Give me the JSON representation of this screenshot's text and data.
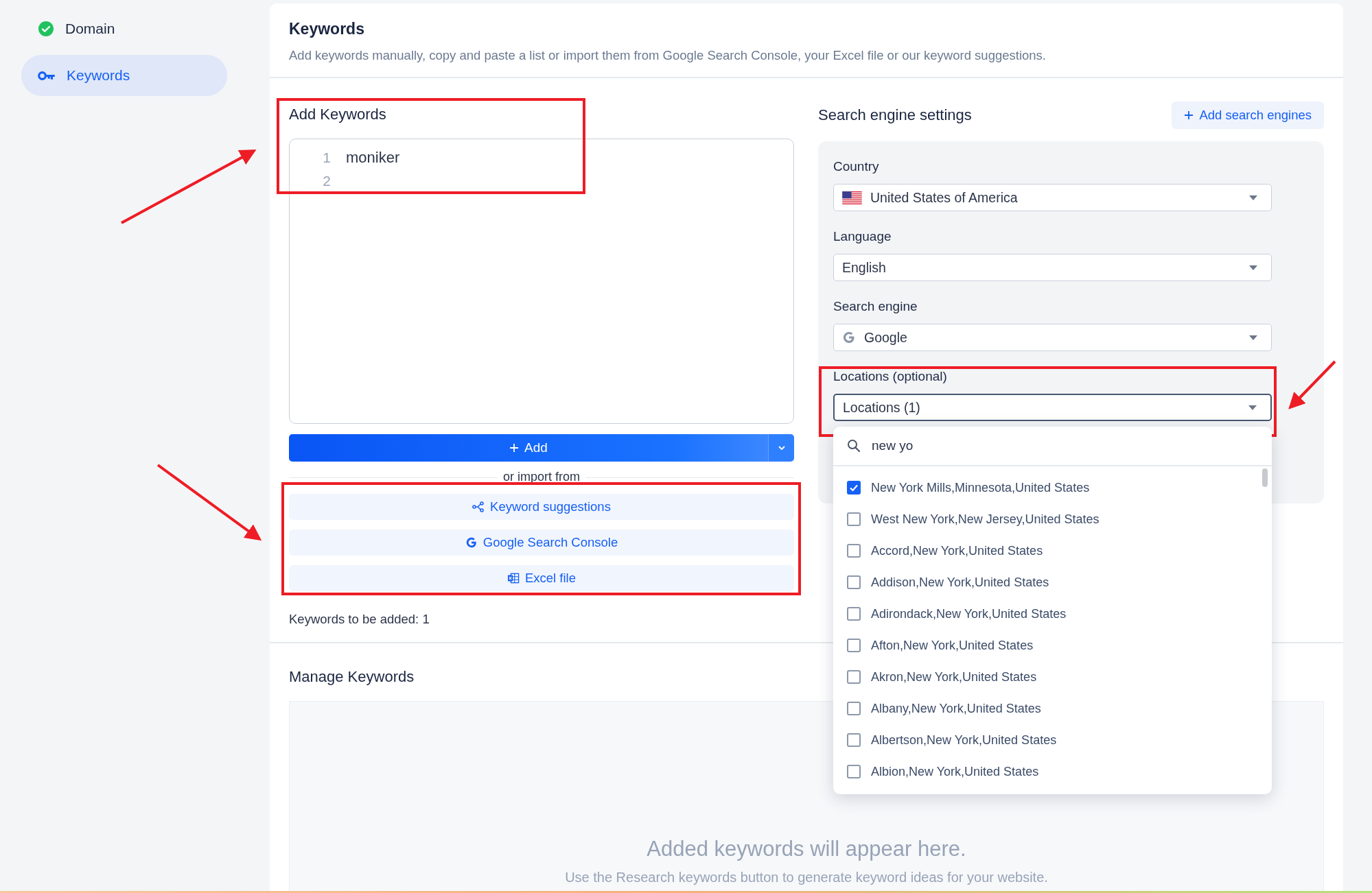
{
  "sidebar": {
    "items": [
      {
        "label": "Domain",
        "kind": "check",
        "selected": false
      },
      {
        "label": "Keywords",
        "kind": "key",
        "selected": true
      }
    ]
  },
  "header": {
    "title": "Keywords",
    "subtitle": "Add keywords manually, copy and paste a list or import them from Google Search Console, your Excel file or our keyword suggestions."
  },
  "add_keywords": {
    "title": "Add Keywords",
    "editor_lines": [
      {
        "number": "1",
        "text": "moniker"
      },
      {
        "number": "2"
      }
    ],
    "add_button": "Add",
    "divider_label": "or import from",
    "import_buttons": [
      {
        "label": "Keyword suggestions",
        "kind": "suggestions"
      },
      {
        "label": "Google Search Console",
        "kind": "google"
      },
      {
        "label": "Excel file",
        "kind": "excel"
      }
    ],
    "count_label": "Keywords to be added: 1"
  },
  "search_engine_settings": {
    "title": "Search engine settings",
    "add_button": "Add search engines",
    "fields": [
      {
        "label": "Country",
        "value": "United States of America",
        "kind": "flag",
        "open": false
      },
      {
        "label": "Language",
        "value": "English",
        "kind": "plain",
        "open": false
      },
      {
        "label": "Search engine",
        "value": "Google",
        "kind": "google",
        "open": false
      },
      {
        "label": "Locations (optional)",
        "value": "Locations (1)",
        "kind": "plain",
        "open": true
      }
    ],
    "dropdown": {
      "search_value": "new yo",
      "options": [
        {
          "label": "New York Mills,Minnesota,United States",
          "checked": true
        },
        {
          "label": "West New York,New Jersey,United States",
          "checked": false
        },
        {
          "label": "Accord,New York,United States",
          "checked": false
        },
        {
          "label": "Addison,New York,United States",
          "checked": false
        },
        {
          "label": "Adirondack,New York,United States",
          "checked": false
        },
        {
          "label": "Afton,New York,United States",
          "checked": false
        },
        {
          "label": "Akron,New York,United States",
          "checked": false
        },
        {
          "label": "Albany,New York,United States",
          "checked": false
        },
        {
          "label": "Albertson,New York,United States",
          "checked": false
        },
        {
          "label": "Albion,New York,United States",
          "checked": false
        }
      ]
    }
  },
  "manage_keywords": {
    "title": "Manage Keywords",
    "empty_title": "Added keywords will appear here.",
    "empty_hint": "Use the Research keywords button to generate keyword ideas for your website."
  }
}
